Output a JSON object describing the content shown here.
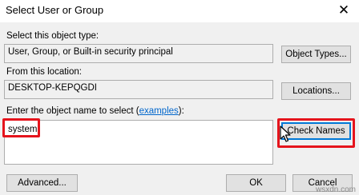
{
  "dialog": {
    "title": "Select User or Group",
    "close_glyph": "✕"
  },
  "object_type": {
    "label": "Select this object type:",
    "value": "User, Group, or Built-in security principal",
    "button_label": "Object Types..."
  },
  "location": {
    "label": "From this location:",
    "value": "DESKTOP-KEPQGDI",
    "button_label": "Locations..."
  },
  "object_name": {
    "label_prefix": "Enter the object name to select (",
    "link_text": "examples",
    "label_suffix": "):",
    "value": "system",
    "check_names_label": "Check Names"
  },
  "footer": {
    "advanced_label": "Advanced...",
    "ok_label": "OK",
    "cancel_label": "Cancel"
  },
  "watermark": "wsxdn.com",
  "colors": {
    "highlight": "#e5141c",
    "link": "#0066cc",
    "default_button_border": "#0078d7",
    "dialog_bg": "#f0f0f0"
  },
  "icons": {
    "close": "close-icon",
    "pointer": "mouse-pointer-icon"
  }
}
